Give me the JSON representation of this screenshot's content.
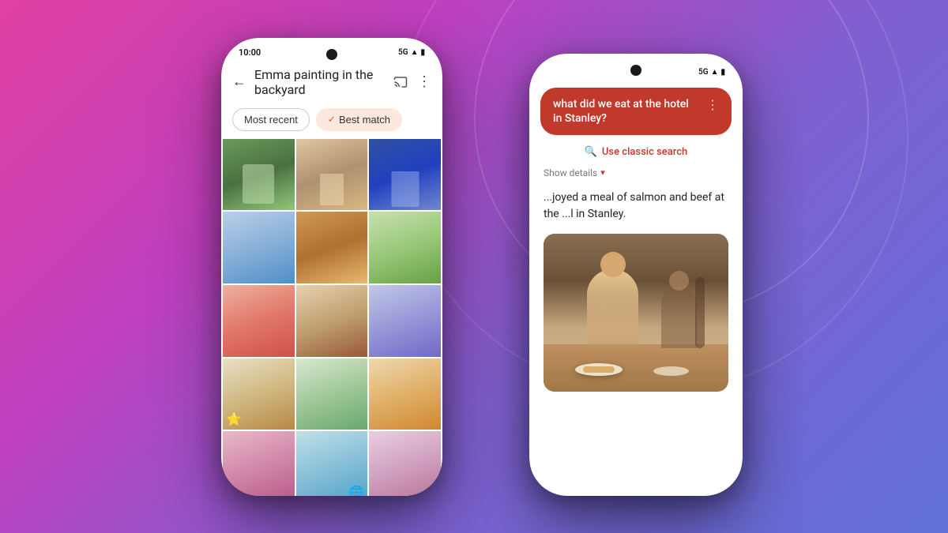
{
  "background": {
    "gradient_start": "#e040a0",
    "gradient_end": "#6070d8"
  },
  "left_phone": {
    "status_bar": {
      "time": "10:00",
      "network": "5G",
      "signal_icon": "📶"
    },
    "header": {
      "back_label": "←",
      "title": "Emma painting in the backyard",
      "cast_icon": "cast-icon",
      "more_icon": "⋮"
    },
    "filters": [
      {
        "label": "Most recent",
        "active": false
      },
      {
        "label": "Best match",
        "active": true
      }
    ],
    "photo_grid": {
      "count": 15,
      "cells": [
        {
          "class": "p1"
        },
        {
          "class": "p2"
        },
        {
          "class": "p3"
        },
        {
          "class": "p4"
        },
        {
          "class": "p5"
        },
        {
          "class": "p6"
        },
        {
          "class": "p7"
        },
        {
          "class": "p8"
        },
        {
          "class": "p9"
        },
        {
          "class": "p10"
        },
        {
          "class": "p11"
        },
        {
          "class": "p12"
        },
        {
          "class": "p13"
        },
        {
          "class": "p14"
        },
        {
          "class": "p15"
        }
      ]
    }
  },
  "right_phone": {
    "status_bar": {
      "network": "5G",
      "signal_icon": "📶"
    },
    "search_bubble": {
      "text": "what did we eat at the hotel in Stanley?",
      "more_icon": "⋮"
    },
    "classic_search": {
      "label": "Use classic search",
      "icon": "🔍"
    },
    "show_details": {
      "label": "Show details",
      "chevron": "▾"
    },
    "answer": {
      "text": "...joyed a meal of salmon and beef at the ...l in Stanley."
    },
    "photo_alt": "Restaurant photo showing people eating at hotel in Stanley"
  }
}
